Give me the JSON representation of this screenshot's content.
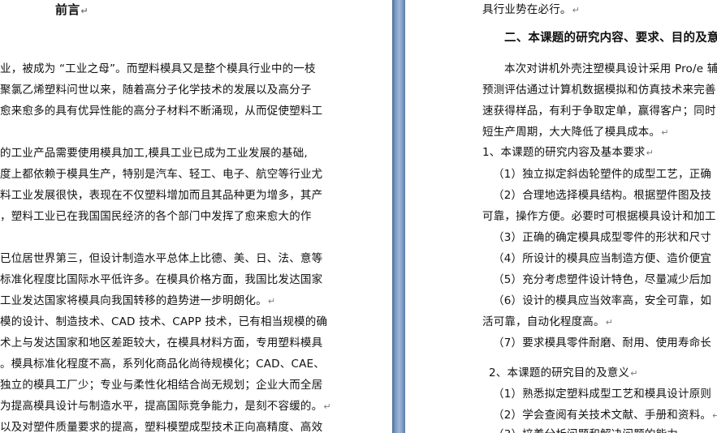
{
  "paragraph_mark": "↵",
  "left_page": {
    "title": "前言",
    "lines": [
      "业，被成为 “工业之母”。而塑料模具又是整个模具行业中的一枝",
      "聚氯乙烯塑料问世以来，随着高分子化学技术的发展以及高分子",
      "愈来愈多的具有优异性能的高分子材料不断涌现，从而促使塑料工",
      "",
      "的工业产品需要使用模具加工,模具工业已成为工业发展的基础,",
      "度上都依赖于模具生产，特别是汽车、轻工、电子、航空等行业尤",
      "料工业发展很快，表现在不仅塑料增加而且其品种更为增多，其产",
      "，塑料工业已在我国国民经济的各个部门中发挥了愈来愈大的作",
      "",
      "已位居世界第三，但设计制造水平总体上比德、美、日、法、意等",
      "标准化程度比国际水平低许多。在模具价格方面，我国比发达国家",
      "工业发达国家将模具向我国转移的趋势进一步明朗化。",
      "模的设计、制造技术、CAD 技术、CAPP 技术，已有相当规模的确",
      "术上与发达国家和地区差距较大，在模具材料方面，专用塑料模具",
      "。模具标准化程度不高，系列化商品化尚待规模化；CAD、CAE、",
      "独立的模具工厂少；专业与柔性化相结合尚无规划；企业大而全居",
      "为提高模具设计与制造水平，提高国际竞争能力，是刻不容缓的。",
      "以及对塑件质量要求的提高，塑料模塑成型技术正向高精度、高效"
    ]
  },
  "right_page": {
    "lines": [
      "具行业势在必行。",
      "二、本课题的研究内容、要求、目的及意义",
      "本次对讲机外壳注塑模具设计采用 Pro/e 辅",
      "预测评估通过计算机数据模拟和仿真技术来完善",
      "速获得样品，有利于争取定单，赢得客户；同时",
      "短生产周期，大大降低了模具成本。",
      "1、本课题的研究内容及基本要求",
      "（1）独立拟定斜齿轮塑件的成型工艺，正确",
      "（2）合理地选择模具结构。根据塑件图及技",
      "可靠，操作方便。必要时可根据模具设计和加工",
      "（3）正确的确定模具成型零件的形状和尺寸",
      "（4）所设计的模具应当制造方便、造价便宜",
      "（5）充分考虑塑件设计特色，尽量减少后加",
      "（6）设计的模具应当效率高，安全可靠，如",
      "活可靠，自动化程度高。",
      "（7）要求模具零件耐磨、耐用、使用寿命长",
      "2、本课题的研究目的及意义",
      "（1）熟悉拟定塑料成型工艺和模具设计原则",
      "（2）学会查阅有关技术文献、手册和资料。",
      "（3）培养分析问题和解决问题的能力"
    ]
  }
}
